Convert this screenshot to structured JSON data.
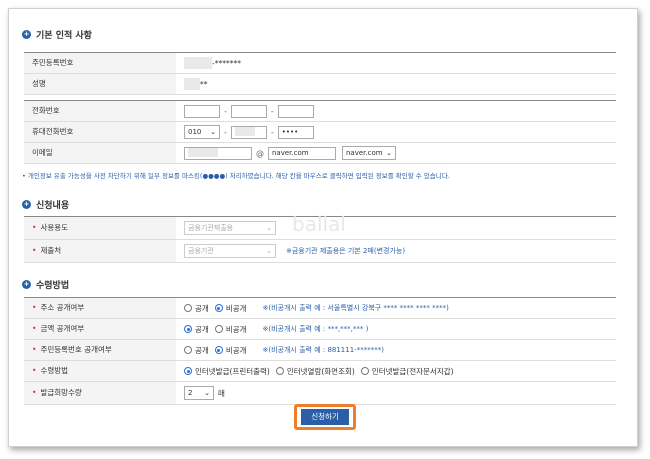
{
  "sections": {
    "basic": "기본 인적 사항",
    "request": "신청내용",
    "receive": "수령방법"
  },
  "basic": {
    "rrn_label": "주민등록번호",
    "rrn_mask": "-*******",
    "name_label": "성명",
    "name_mask": "**",
    "phone_label": "전화번호",
    "mobile_label": "휴대전화번호",
    "mobile_prefix": "010",
    "mobile_last": "••••",
    "email_label": "이메일",
    "email_at": "@",
    "email_domain": "naver.com",
    "email_domain_select": "naver.com"
  },
  "notice": "• 개인정보 유출 가능성을 사전 차단하기 위해 일부 정보를 마스킹(●●●●) 처리하였습니다. 해당 칸을 마우스로 클릭하면 입력된 정보를 확인할 수 있습니다.",
  "request": {
    "purpose_label": "사용용도",
    "purpose_value": "금융기관제출용",
    "submit_to_label": "제출처",
    "submit_to_value": "금융기관",
    "submit_to_note": "※금융기관 제출용은 기본 2매(변경가능)"
  },
  "watermark": "ballal",
  "receive": {
    "addr_label": "주소 공개여부",
    "addr_opt1": "공개",
    "addr_opt2": "비공개",
    "addr_note": "※(비공개시 출력 예 : 서울특별시 강북구 **** **** **** ****)",
    "amount_label": "금액 공개여부",
    "amount_opt1": "공개",
    "amount_opt2": "비공개",
    "amount_note": "※(비공개시 출력 예 : ***,***,*** )",
    "rrn_label": "주민등록번호 공개여부",
    "rrn_opt1": "공개",
    "rrn_opt2": "비공개",
    "rrn_note": "※(비공개시 출력 예 : 881111-*******)",
    "method_label": "수령방법",
    "method_opt1": "인터넷발급(프린터출력)",
    "method_opt2": "인터넷열람(화면조회)",
    "method_opt3": "인터넷발급(전자문서지갑)",
    "count_label": "발급희망수량",
    "count_value": "2",
    "count_unit": "매"
  },
  "submit_label": "신청하기"
}
